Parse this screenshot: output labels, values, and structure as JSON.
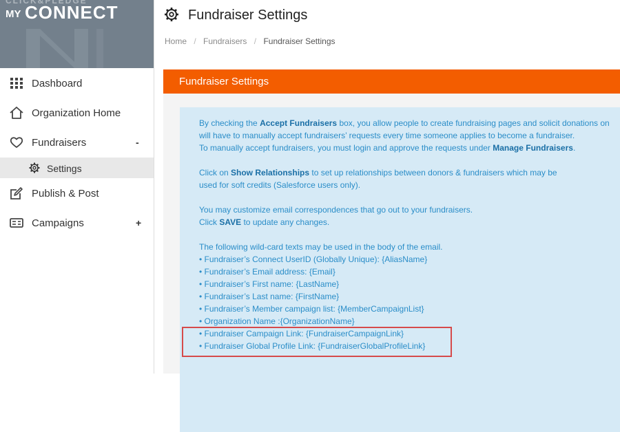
{
  "logo": {
    "top": "CLICK&PLEDGE",
    "my": "MY",
    "connect": "CONNECT"
  },
  "sidebar": {
    "items": [
      {
        "label": "Dashboard",
        "icon": "grid-icon"
      },
      {
        "label": "Organization Home",
        "icon": "home-icon"
      },
      {
        "label": "Fundraisers",
        "icon": "heart-icon",
        "toggle": "-"
      },
      {
        "label": "Publish & Post",
        "icon": "edit-icon"
      },
      {
        "label": "Campaigns",
        "icon": "id-card-icon",
        "toggle": "+"
      }
    ],
    "sub_item": {
      "label": "Settings",
      "icon": "gear-icon"
    }
  },
  "page": {
    "title": "Fundraiser Settings"
  },
  "breadcrumb": {
    "home": "Home",
    "fundraisers": "Fundraisers",
    "current": "Fundraiser Settings",
    "separator": "/"
  },
  "panel": {
    "title": "Fundraiser Settings",
    "text": {
      "p1_a": "By checking the ",
      "p1_b": "Accept Fundraisers",
      "p1_c": " box, you allow people to create fundraising pages and solicit donations on",
      "p1_line2": "will have to manually accept fundraisers’ requests every time someone applies to become a fundraiser.",
      "p1_line3_a": "To manually accept fundraisers, you must login and approve the requests under ",
      "p1_line3_b": "Manage Fundraisers",
      "p1_line3_c": ".",
      "p2_a": "Click on ",
      "p2_b": "Show Relationships",
      "p2_c": " to set up relationships between donors & fundraisers which may be",
      "p2_line2": "used for soft credits (Salesforce users only).",
      "p3_line1": "You may customize email correspondences that go out to your fundraisers.",
      "p3_line2_a": "Click ",
      "p3_line2_b": "SAVE",
      "p3_line2_c": " to update any changes.",
      "p4_intro": "The following wild-card texts may be used in the body of the email.",
      "wildcards": [
        "• Fundraiser’s Connect UserID (Globally Unique): {AliasName}",
        "• Fundraiser’s Email address: {Email}",
        "• Fundraiser’s First name: {LastName}",
        "• Fundraiser’s Last name: {FirstName}",
        "• Fundraiser’s Member campaign list: {MemberCampaignList}",
        "• Organization Name :{OrganizationName}",
        "• Fundraiser Campaign Link: {FundraiserCampaignLink}",
        "• Fundraiser Global Profile Link: {FundraiserGlobalProfileLink}"
      ]
    }
  },
  "colors": {
    "accent": "#f35d00",
    "info_bg": "#d6eaf6",
    "info_text": "#2a8dc8",
    "highlight": "#d64a4a",
    "logo_bg": "#73808c"
  }
}
